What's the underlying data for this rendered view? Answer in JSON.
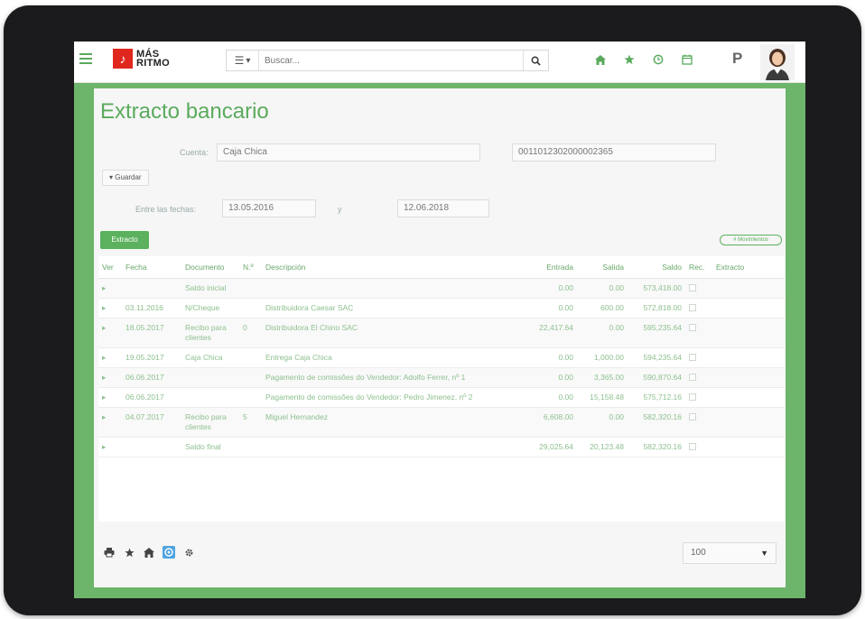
{
  "app": {
    "logo_line1": "MÁS",
    "logo_line2": "RITMO",
    "logo_glyph": "♪"
  },
  "search": {
    "placeholder": "Buscar..."
  },
  "page": {
    "title": "Extracto bancario"
  },
  "form": {
    "cuenta_label": "Cuenta:",
    "cuenta_value": "Caja Chica",
    "iban_value": "0011012302000002365",
    "collapse_label": "Guardar",
    "fechas_label": "Entre las fechas:",
    "fecha_desde": "13.05.2016",
    "fechas_sep": "y",
    "fecha_hasta": "12.06.2018"
  },
  "actions": {
    "extracto_button": "Extracto",
    "pill_label": "# Movimientos"
  },
  "table": {
    "headers": {
      "ver": "Ver",
      "fecha": "Fecha",
      "documento": "Documento",
      "n": "N.º",
      "descripcion": "Descripción",
      "entrada": "Entrada",
      "salida": "Salida",
      "saldo": "Saldo",
      "rec": "Rec.",
      "extracto": "Extracto"
    },
    "rows": [
      {
        "ver": "▸",
        "fecha": "",
        "documento": "Saldo inicial",
        "n": "",
        "descripcion": "",
        "entrada": "0.00",
        "salida": "0.00",
        "saldo": "573,418.00"
      },
      {
        "ver": "▸",
        "fecha": "03.11.2016",
        "documento": "N/Cheque",
        "n": "",
        "descripcion": "Distribuidora Caesar SAC",
        "entrada": "0.00",
        "salida": "600.00",
        "saldo": "572,818.00"
      },
      {
        "ver": "▸",
        "fecha": "18.05.2017",
        "documento": "Recibo para clientes",
        "n": "0",
        "descripcion": "Distribuidora El Chino SAC",
        "entrada": "22,417.64",
        "salida": "0.00",
        "saldo": "595,235.64"
      },
      {
        "ver": "▸",
        "fecha": "19.05.2017",
        "documento": "Caja Chica",
        "n": "",
        "descripcion": "Entrega Caja Chica",
        "entrada": "0.00",
        "salida": "1,000.00",
        "saldo": "594,235.64"
      },
      {
        "ver": "▸",
        "fecha": "06.06.2017",
        "documento": "",
        "n": "",
        "descripcion": "Pagamento de comissões do Vendedor: Adolfo Ferrer, nº 1",
        "entrada": "0.00",
        "salida": "3,365.00",
        "saldo": "590,870.64"
      },
      {
        "ver": "▸",
        "fecha": "06.06.2017",
        "documento": "",
        "n": "",
        "descripcion": "Pagamento de comissões do Vendedor: Pedro Jimenez, nº 2",
        "entrada": "0.00",
        "salida": "15,158.48",
        "saldo": "575,712.16"
      },
      {
        "ver": "▸",
        "fecha": "04.07.2017",
        "documento": "Recibo para clientes",
        "n": "5",
        "descripcion": "Miguel Hernandez",
        "entrada": "6,608.00",
        "salida": "0.00",
        "saldo": "582,320.16"
      },
      {
        "ver": "▸",
        "fecha": "",
        "documento": "Saldo final",
        "n": "",
        "descripcion": "",
        "entrada": "29,025.64",
        "salida": "20,123.48",
        "saldo": "582,320.16"
      }
    ]
  },
  "footer": {
    "page_size": "100"
  },
  "colors": {
    "brand_green": "#5bab5d",
    "band_green": "#6db56a",
    "logo_red": "#e0271d"
  }
}
